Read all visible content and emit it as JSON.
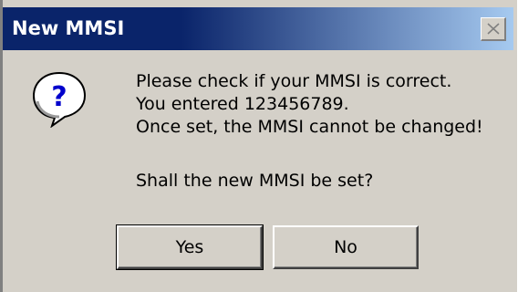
{
  "window": {
    "title": "New MMSI",
    "close_icon": "close-icon",
    "colors": {
      "titlebar_start": "#0a246a",
      "titlebar_end": "#a6caf0",
      "face": "#d4d0c8"
    }
  },
  "dialog": {
    "icon": "question-icon",
    "icon_glyph": "?",
    "message_lines": [
      "Please check if your MMSI is correct.",
      "You entered 123456789.",
      "Once set, the MMSI cannot be changed!"
    ],
    "prompt": "Shall the new MMSI be set?"
  },
  "buttons": {
    "yes_label": "Yes",
    "no_label": "No"
  }
}
